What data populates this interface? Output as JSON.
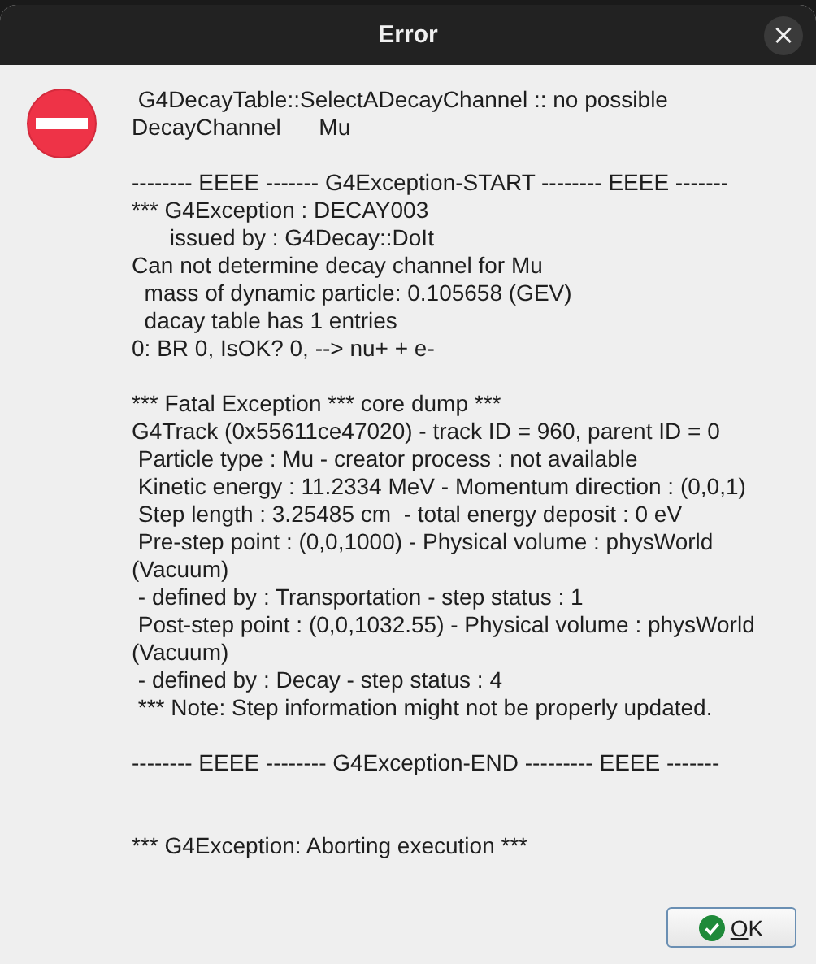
{
  "window": {
    "title": "Error",
    "close": "×"
  },
  "message": {
    "paragraphs": [
      {
        "lines": [
          " G4DecayTable::SelectADecayChannel :: no possible",
          "DecayChannel      Mu"
        ]
      },
      {
        "lines": [
          "-------- EEEE ------- G4Exception-START -------- EEEE -------",
          "*** G4Exception : DECAY003",
          "      issued by : G4Decay::DoIt",
          "Can not determine decay channel for Mu",
          "  mass of dynamic particle: 0.105658 (GEV)",
          "  dacay table has 1 entries",
          "0: BR 0, IsOK? 0, --> nu+ + e-"
        ]
      },
      {
        "lines": [
          "*** Fatal Exception *** core dump ***",
          "G4Track (0x55611ce47020) - track ID = 960, parent ID = 0",
          " Particle type : Mu - creator process : not available",
          " Kinetic energy : 11.2334 MeV - Momentum direction : (0,0,1)",
          " Step length : 3.25485 cm  - total energy deposit : 0 eV",
          " Pre-step point : (0,0,1000) - Physical volume : physWorld",
          "(Vacuum)",
          " - defined by : Transportation - step status : 1",
          " Post-step point : (0,0,1032.55) - Physical volume : physWorld",
          "(Vacuum)",
          " - defined by : Decay - step status : 4",
          " *** Note: Step information might not be properly updated."
        ]
      },
      {
        "lines": [
          "-------- EEEE -------- G4Exception-END --------- EEEE -------"
        ]
      },
      {
        "lines": [
          "*** G4Exception: Aborting execution ***"
        ]
      }
    ]
  },
  "buttons": [
    {
      "label": "OK"
    }
  ]
}
